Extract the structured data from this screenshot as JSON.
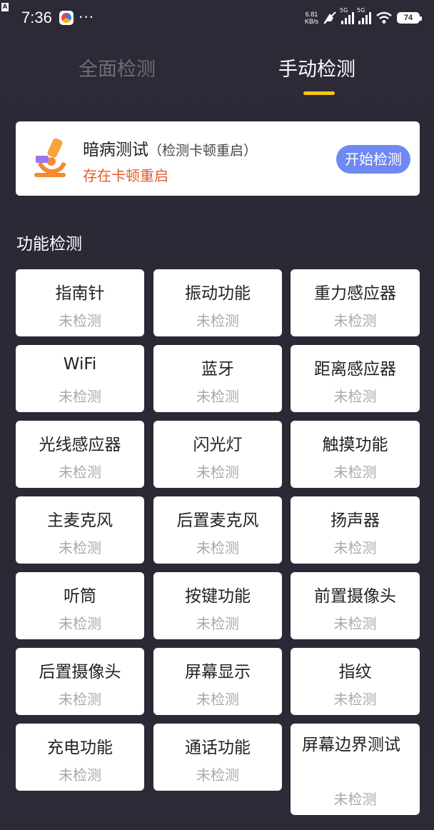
{
  "status_bar": {
    "time": "7:36",
    "dots": "···",
    "net_speed_value": "6.81",
    "net_speed_unit": "KB/s",
    "sim1": "5G",
    "sim2": "5G",
    "battery": "74",
    "corner_badge": "A"
  },
  "tabs": [
    {
      "label": "全面检测",
      "active": false
    },
    {
      "label": "手动检测",
      "active": true
    }
  ],
  "hidden_test": {
    "title": "暗病测试",
    "subtitle": "（检测卡顿重启）",
    "status": "存在卡顿重启",
    "button": "开始检测"
  },
  "section_title": "功能检测",
  "items": [
    {
      "name": "指南针",
      "state": "未检测"
    },
    {
      "name": "振动功能",
      "state": "未检测"
    },
    {
      "name": "重力感应器",
      "state": "未检测"
    },
    {
      "name": "WiFi",
      "state": "未检测"
    },
    {
      "name": "蓝牙",
      "state": "未检测"
    },
    {
      "name": "距离感应器",
      "state": "未检测"
    },
    {
      "name": "光线感应器",
      "state": "未检测"
    },
    {
      "name": "闪光灯",
      "state": "未检测"
    },
    {
      "name": "触摸功能",
      "state": "未检测"
    },
    {
      "name": "主麦克风",
      "state": "未检测"
    },
    {
      "name": "后置麦克风",
      "state": "未检测"
    },
    {
      "name": "扬声器",
      "state": "未检测"
    },
    {
      "name": "听筒",
      "state": "未检测"
    },
    {
      "name": "按键功能",
      "state": "未检测"
    },
    {
      "name": "前置摄像头",
      "state": "未检测"
    },
    {
      "name": "后置摄像头",
      "state": "未检测"
    },
    {
      "name": "屏幕显示",
      "state": "未检测"
    },
    {
      "name": "指纹",
      "state": "未检测"
    },
    {
      "name": "充电功能",
      "state": "未检测"
    },
    {
      "name": "通话功能",
      "state": "未检测"
    },
    {
      "name": "屏幕边界测试",
      "state": "未检测"
    }
  ],
  "colors": {
    "background": "#2b2a36",
    "tab_inactive": "#6f6e78",
    "tab_indicator": "#f6c51b",
    "button_bg": "#6f88f2",
    "warning_text": "#e8582d",
    "state_text": "#a9a9a9"
  }
}
